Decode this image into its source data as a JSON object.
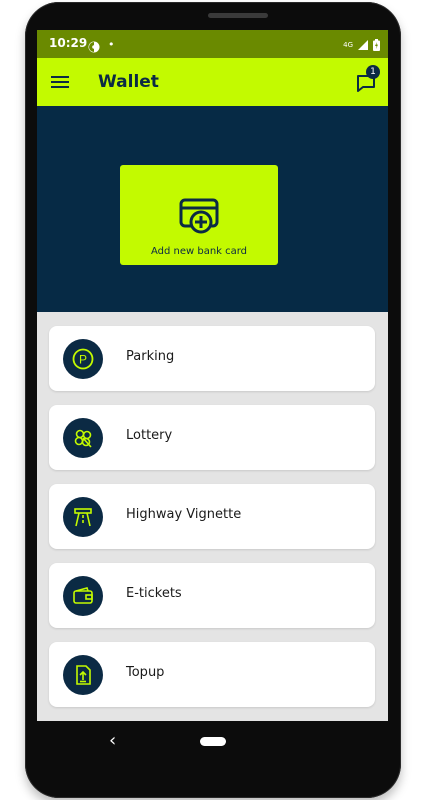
{
  "status": {
    "time": "10:29",
    "dot": "•",
    "network": "4G"
  },
  "appbar": {
    "title": "Wallet",
    "badge_count": "1"
  },
  "hero": {
    "add_card_label": "Add new bank card"
  },
  "items": [
    {
      "label": "Parking",
      "icon": "parking-icon"
    },
    {
      "label": "Lottery",
      "icon": "clover-icon"
    },
    {
      "label": "Highway Vignette",
      "icon": "highway-icon"
    },
    {
      "label": "E-tickets",
      "icon": "wallet-icon"
    },
    {
      "label": "Topup",
      "icon": "topup-icon"
    }
  ],
  "nav": {
    "back": "‹"
  },
  "colors": {
    "accent": "#c3fa00",
    "dark": "#062a45",
    "status_bar": "#6a8a00"
  }
}
